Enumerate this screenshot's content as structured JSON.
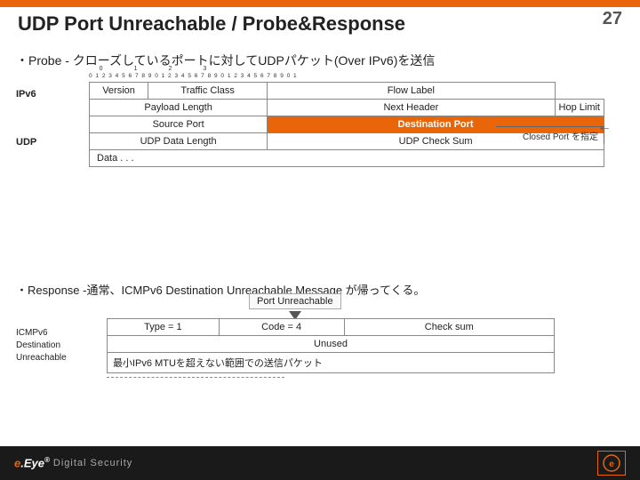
{
  "slide": {
    "number": "27",
    "title": "UDP Port Unreachable / Probe&Response",
    "top_bar_color": "#e8650a"
  },
  "section1": {
    "bullet": "・Probe - クローズしているポートに対してUDPパケット(Over IPv6)を送信"
  },
  "section2": {
    "bullet": "・Response -通常、ICMPv6 Destination Unreachable Message が帰ってくる。"
  },
  "ruler": {
    "top_numbers": "0                   1                   2                   3",
    "bit_numbers": "0 1 2 3 4 5 6 7 8 9 0 1 2 3 4 5 6 7 8 9 0 1 2 3 4 5 6 7 8 9 0 1"
  },
  "ipv6_label": "IPv6",
  "udp_label": "UDP",
  "rows": {
    "r1": {
      "c1": "Version",
      "c2": "Traffic Class",
      "c3": "Flow Label"
    },
    "r2": {
      "c1": "Payload Length",
      "c2": "Next Header",
      "c3": "Hop Limit"
    },
    "r3": {
      "c1": "Source Port",
      "c2_label": "Destination Port",
      "c2_class": "dest-port"
    },
    "r4": {
      "c1": "UDP Data Length",
      "c2": "UDP Check Sum"
    },
    "r5": {
      "c1": "Data . . ."
    }
  },
  "closed_port_label": "Closed Port を指定",
  "port_unreachable": {
    "label": "Port Unreachable"
  },
  "icmp_rows": {
    "r1": {
      "type_label": "Type = ",
      "type_val": "1",
      "code_label": "Code = ",
      "code_val": "4",
      "c3": "Check sum"
    },
    "r2": {
      "c1": "Unused"
    },
    "r3": {
      "c1": "最小IPv6 MTUを超えない範囲での送信パケット"
    }
  },
  "icmpv6_label": "ICMPv6\nDestination\nUnreachable",
  "bottom": {
    "logo": "e.Eye",
    "reg": "®",
    "tagline": "Digital Security"
  }
}
